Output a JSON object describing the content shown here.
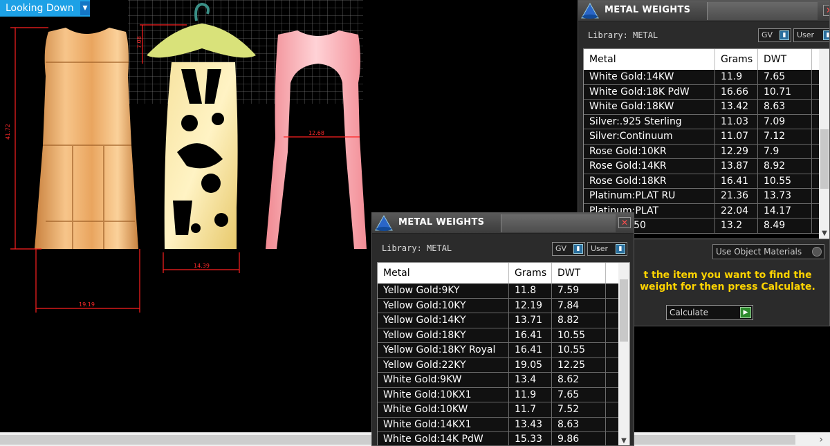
{
  "viewport": {
    "view_mode": "Looking Down",
    "dimensions": {
      "dress_height": "41.72",
      "dress_width": "19.19",
      "pendant_width": "14.39",
      "hanger_height": "7.08",
      "outline_width": "12.68"
    }
  },
  "back_panel": {
    "title": "METAL WEIGHTS",
    "library": "Library: METAL",
    "toggle_gv": "GV",
    "toggle_user": "User",
    "columns": [
      "Metal",
      "Grams",
      "DWT"
    ],
    "rows": [
      [
        "White Gold:14KW",
        "11.9",
        "7.65"
      ],
      [
        "White Gold:18K PdW",
        "16.66",
        "10.71"
      ],
      [
        "White Gold:18KW",
        "13.42",
        "8.63"
      ],
      [
        "Silver:.925 Sterling",
        "11.03",
        "7.09"
      ],
      [
        "Silver:Continuum",
        "11.07",
        "7.12"
      ],
      [
        "Rose Gold:10KR",
        "12.29",
        "7.9"
      ],
      [
        "Rose Gold:14KR",
        "13.87",
        "8.92"
      ],
      [
        "Rose Gold:18KR",
        "16.41",
        "10.55"
      ],
      [
        "Platinum:PLAT RU",
        "21.36",
        "13.73"
      ],
      [
        "Platinum:PLAT",
        "22.04",
        "14.17"
      ],
      [
        "n:PALL .950",
        "13.2",
        "8.49"
      ]
    ],
    "use_object_materials": "Use Object Materials",
    "instruction": "t the item you want to find the weight for then press Calculate.",
    "calculate_label": "Calculate"
  },
  "front_panel": {
    "title": "METAL WEIGHTS",
    "library": "Library: METAL",
    "toggle_gv": "GV",
    "toggle_user": "User",
    "columns": [
      "Metal",
      "Grams",
      "DWT"
    ],
    "rows": [
      [
        "Yellow Gold:9KY",
        "11.8",
        "7.59"
      ],
      [
        "Yellow Gold:10KY",
        "12.19",
        "7.84"
      ],
      [
        "Yellow Gold:14KY",
        "13.71",
        "8.82"
      ],
      [
        "Yellow Gold:18KY",
        "16.41",
        "10.55"
      ],
      [
        "Yellow Gold:18KY Royal",
        "16.41",
        "10.55"
      ],
      [
        "Yellow Gold:22KY",
        "19.05",
        "12.25"
      ],
      [
        "White Gold:9KW",
        "13.4",
        "8.62"
      ],
      [
        "White Gold:10KX1",
        "11.9",
        "7.65"
      ],
      [
        "White Gold:10KW",
        "11.7",
        "7.52"
      ],
      [
        "White Gold:14KX1",
        "13.43",
        "8.63"
      ],
      [
        "White Gold:14K PdW",
        "15.33",
        "9.86"
      ]
    ]
  }
}
